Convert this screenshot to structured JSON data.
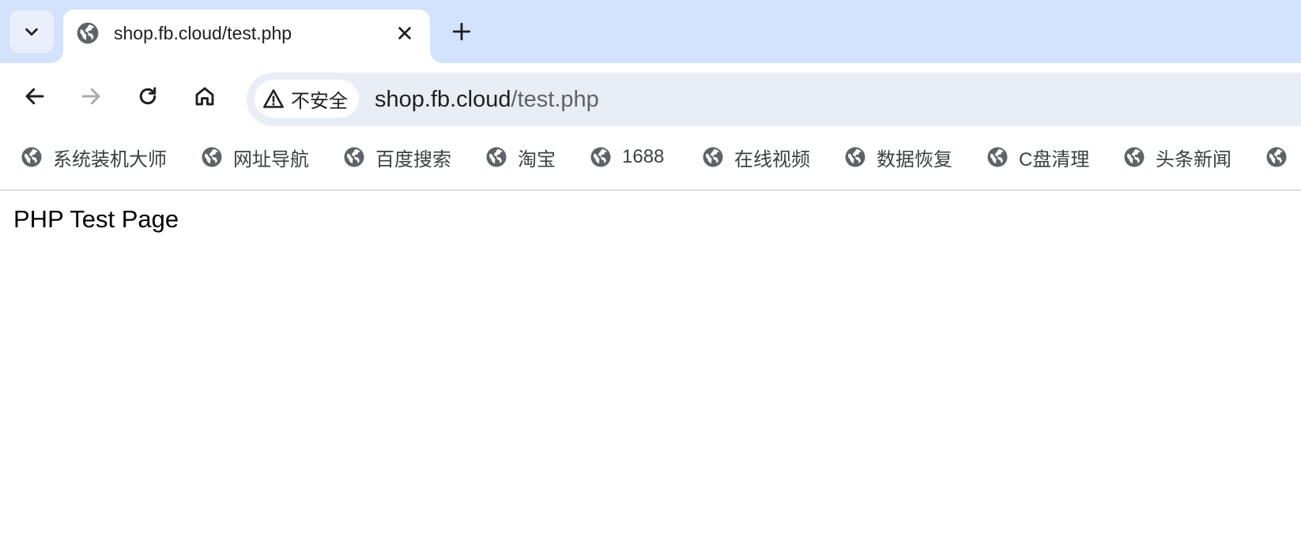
{
  "tab": {
    "title": "shop.fb.cloud/test.php",
    "favicon": "globe-icon"
  },
  "omnibox": {
    "security_label": "不安全",
    "url_host": "shop.fb.cloud",
    "url_path": "/test.php"
  },
  "bookmarks": [
    {
      "label": "系统装机大师",
      "icon": "globe-icon"
    },
    {
      "label": "网址导航",
      "icon": "globe-icon"
    },
    {
      "label": "百度搜索",
      "icon": "globe-icon"
    },
    {
      "label": "淘宝",
      "icon": "globe-icon"
    },
    {
      "label": "1688",
      "icon": "globe-icon"
    },
    {
      "label": "在线视频",
      "icon": "globe-icon"
    },
    {
      "label": "数据恢复",
      "icon": "globe-icon"
    },
    {
      "label": "C盘清理",
      "icon": "globe-icon"
    },
    {
      "label": "头条新闻",
      "icon": "globe-icon"
    },
    {
      "label": "",
      "icon": "globe-icon"
    }
  ],
  "page": {
    "heading": "PHP Test Page"
  },
  "colors": {
    "tabstrip": "#d3e3fd",
    "omnibox": "#e9eef6",
    "icon": "#5f6368"
  }
}
